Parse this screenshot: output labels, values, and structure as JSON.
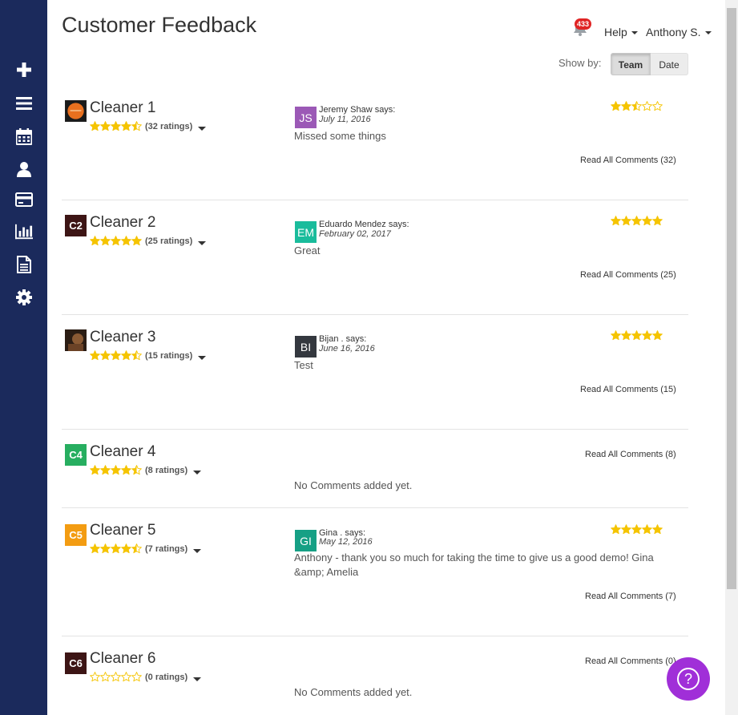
{
  "header": {
    "title": "Customer Feedback",
    "notification_count": "433",
    "help_label": "Help",
    "user_label": "Anthony S.",
    "showby_label": "Show by:",
    "toggle_team": "Team",
    "toggle_date": "Date"
  },
  "sidebar": {
    "items": [
      {
        "icon": "plus-icon"
      },
      {
        "icon": "list-icon"
      },
      {
        "icon": "calendar-icon"
      },
      {
        "icon": "user-icon"
      },
      {
        "icon": "credit-card-icon"
      },
      {
        "icon": "bar-chart-icon"
      },
      {
        "icon": "document-icon"
      },
      {
        "icon": "gear-icon"
      }
    ]
  },
  "cleaners": [
    {
      "name": "Cleaner 1",
      "avatar_initials": "",
      "avatar_color": "#e8701f",
      "rating": 4.5,
      "rating_count": "(32 ratings)",
      "comment": {
        "initials": "JS",
        "color": "#9b59b6",
        "author": "Jeremy Shaw says:",
        "date": "July 11, 2016",
        "text": "Missed some things",
        "stars": 2.5
      },
      "read_all": "Read All Comments (32)"
    },
    {
      "name": "Cleaner 2",
      "avatar_initials": "C2",
      "avatar_color": "#3d1515",
      "rating": 5,
      "rating_count": "(25 ratings)",
      "comment": {
        "initials": "EM",
        "color": "#1abc9c",
        "author": "Eduardo Mendez says:",
        "date": "February 02, 2017",
        "text": "Great",
        "stars": 5
      },
      "read_all": "Read All Comments (25)"
    },
    {
      "name": "Cleaner 3",
      "avatar_initials": "",
      "avatar_color": "#5a3a22",
      "rating": 4.5,
      "rating_count": "(15 ratings)",
      "comment": {
        "initials": "BI",
        "color": "#34383f",
        "author": "Bijan . says:",
        "date": "June 16, 2016",
        "text": "Test",
        "stars": 5
      },
      "read_all": "Read All Comments (15)"
    },
    {
      "name": "Cleaner 4",
      "avatar_initials": "C4",
      "avatar_color": "#27ae60",
      "rating": 4.5,
      "rating_count": "(8 ratings)",
      "no_comments": "No Comments added yet.",
      "read_all": "Read All Comments (8)"
    },
    {
      "name": "Cleaner 5",
      "avatar_initials": "C5",
      "avatar_color": "#f39c12",
      "rating": 4.5,
      "rating_count": "(7 ratings)",
      "comment": {
        "initials": "GI",
        "color": "#16a085",
        "author": "Gina . says:",
        "date": "May 12, 2016",
        "text": "Anthony - thank you so much for taking the time to give us a good demo! Gina &amp; Amelia",
        "stars": 5
      },
      "read_all": "Read All Comments (7)"
    },
    {
      "name": "Cleaner 6",
      "avatar_initials": "C6",
      "avatar_color": "#3d1515",
      "rating": 0,
      "rating_count": "(0 ratings)",
      "no_comments": "No Comments added yet.",
      "read_all": "Read All Comments (0)"
    }
  ],
  "colors": {
    "sidebar": "#1b2a5c",
    "star": "#f5c400",
    "badge": "#e02424",
    "help_fab": "#a02fd8"
  },
  "help_fab_label": "?"
}
